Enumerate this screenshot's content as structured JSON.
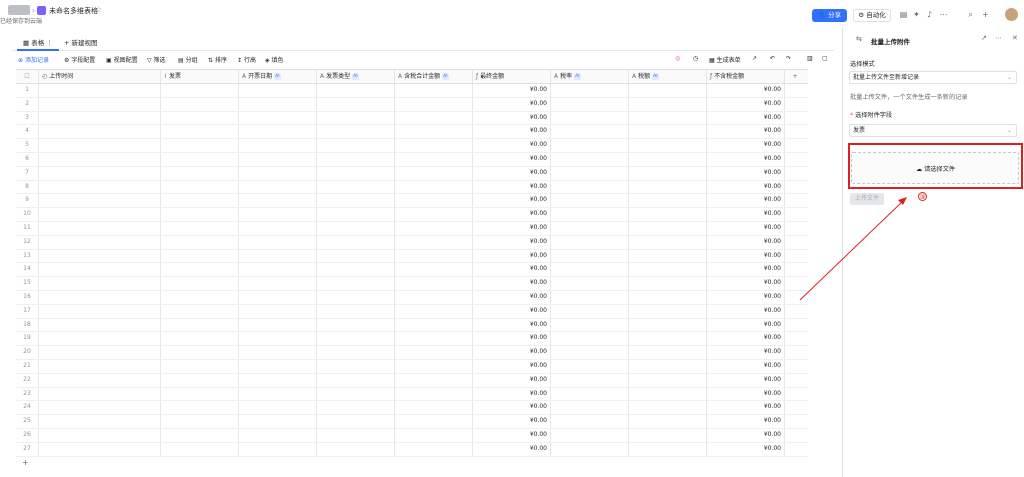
{
  "topbar": {
    "breadcrumb_sub": "已经保存到云端",
    "title": "未命名多维表格",
    "share_label": "分享",
    "auto_label": "自动化"
  },
  "view": {
    "tab_active": "表格",
    "tab_new": "+ 新建视图"
  },
  "toolbar": {
    "add_record": "添加记录",
    "field_config": "字段配置",
    "view_config": "视图配置",
    "filter": "筛选",
    "group": "分组",
    "sort": "排序",
    "row_height": "行高",
    "fill_color": "填色",
    "generate_form": "生成表单"
  },
  "table": {
    "headers": [
      "上传时间",
      "发票",
      "开票日期",
      "发票类型",
      "含税合计金额",
      "最终金额",
      "税率",
      "税额",
      "不含税金额"
    ],
    "row_count": 27,
    "currency_value": "¥0.00",
    "rows": [
      1,
      2,
      3,
      4,
      5,
      6,
      7,
      8,
      9,
      10,
      11,
      12,
      13,
      14,
      15,
      16,
      17,
      18,
      19,
      20,
      21,
      22,
      23,
      24,
      25,
      26,
      27
    ]
  },
  "panel": {
    "title": "批量上传附件",
    "mode_label": "选择模式",
    "mode_value": "批量上传文件至新增记录",
    "mode_desc": "批量上传文件，一个文件生成一条新的记录",
    "field_label": "选择附件字段",
    "field_value": "发票",
    "dropzone_text": "请选择文件",
    "upload_button": "上传文件",
    "annotation": "③"
  },
  "colors": {
    "accent": "#3370ff",
    "annotation": "#e02020"
  }
}
